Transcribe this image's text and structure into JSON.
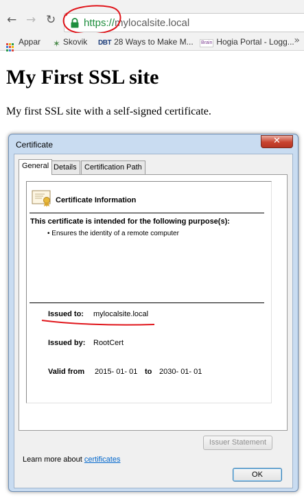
{
  "browser": {
    "url_scheme": "https://",
    "url_host": "mylocalsite.local",
    "bookmarks": [
      {
        "label": "Appar"
      },
      {
        "label": "Skovik"
      },
      {
        "label": "28 Ways to Make M..."
      },
      {
        "label": "Hogia Portal - Logg..."
      }
    ],
    "bookmark_icons": {
      "dbt": "DBT",
      "brain": "Brain"
    },
    "more_label": "»"
  },
  "page": {
    "heading": "My First SSL site",
    "paragraph": "My first SSL site with a self-signed certificate."
  },
  "dialog": {
    "title": "Certificate",
    "close_label": "✕",
    "tabs": [
      {
        "label": "General",
        "active": true
      },
      {
        "label": "Details",
        "active": false
      },
      {
        "label": "Certification Path",
        "active": false
      }
    ],
    "info_heading": "Certificate Information",
    "purpose_heading": "This certificate is intended for the following purpose(s):",
    "purpose_items": [
      "Ensures the identity of a remote computer"
    ],
    "issued_to_label": "Issued to:",
    "issued_to_value": "mylocalsite.local",
    "issued_by_label": "Issued by:",
    "issued_by_value": "RootCert",
    "valid_from_label": "Valid from",
    "valid_from_value": "2015- 01- 01",
    "valid_to_label": "to",
    "valid_to_value": "2030- 01- 01",
    "issuer_statement_label": "Issuer Statement",
    "learn_more_prefix": "Learn more about ",
    "learn_more_link": "certificates",
    "ok_label": "OK"
  },
  "colors": {
    "https_green": "#1e8e3e",
    "annotation_red": "#e0151b",
    "link_blue": "#0066cc"
  },
  "icons": [
    "back-arrow-icon",
    "forward-arrow-icon",
    "reload-icon",
    "lock-icon",
    "apps-grid-icon",
    "star-icon",
    "certificate-icon"
  ]
}
